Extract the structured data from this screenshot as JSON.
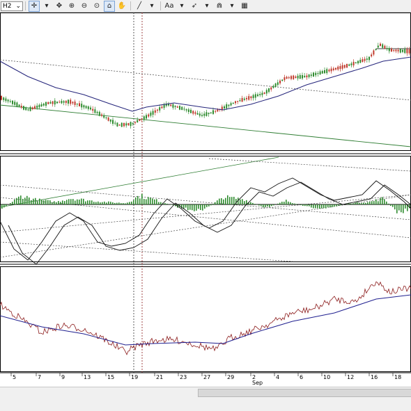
{
  "toolbar": {
    "timeframe": "H2",
    "text_tool_label": "Aa"
  },
  "x_axis": {
    "dates": [
      "5",
      "7",
      "9",
      "13",
      "15",
      "19",
      "21",
      "23",
      "27",
      "29",
      "2",
      "4",
      "6",
      "10",
      "12",
      "16",
      "18"
    ],
    "month_label": "Sep"
  },
  "chart_data": [
    {
      "type": "candlestick",
      "panel": "price",
      "overlays": [
        "moving average (blue)",
        "trend lines (dotted)",
        "trend line (green)"
      ]
    },
    {
      "type": "histogram",
      "panel": "oscillator",
      "overlays": [
        "signal lines (black)",
        "trend lines (dotted)",
        "trend line (green)"
      ]
    },
    {
      "type": "line",
      "panel": "indicator",
      "series_colors": [
        "#8b1a1a",
        "#1f1f8f"
      ]
    }
  ],
  "colors": {
    "bull": "#2e8b2e",
    "bear": "#c0392b",
    "ma": "#23237a",
    "trend": "#2e7d32",
    "price_line": "#8b1a1a"
  }
}
